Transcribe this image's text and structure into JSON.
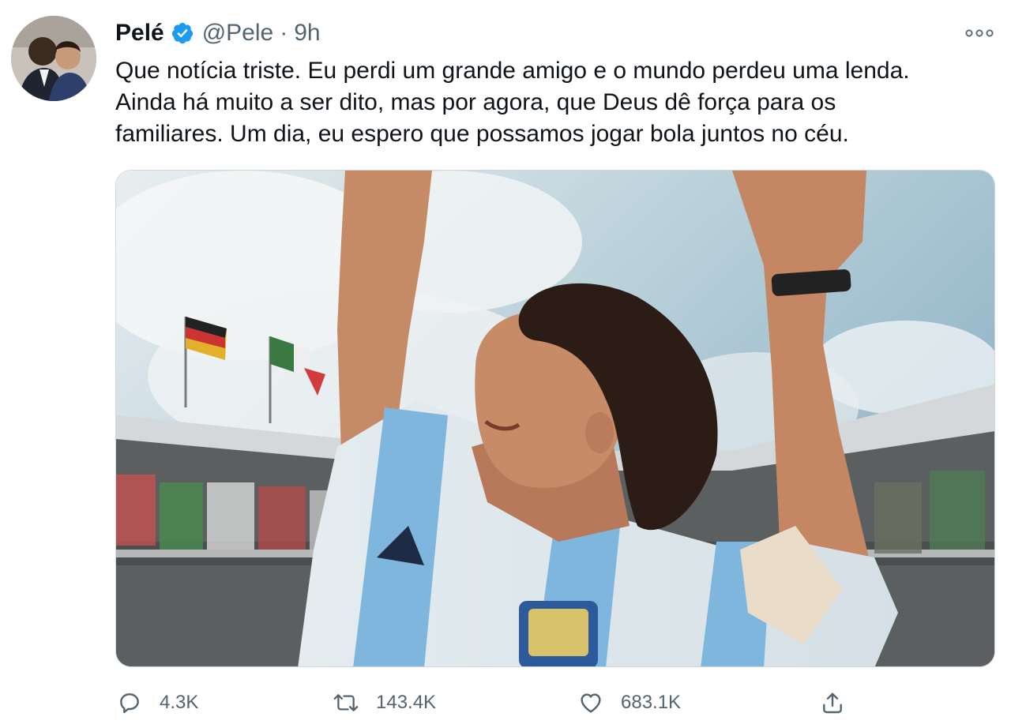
{
  "tweet": {
    "author_name": "Pelé",
    "handle": "@Pele",
    "separator": "·",
    "time": "9h",
    "text_lines": [
      "Que notícia triste. Eu perdi um grande amigo e o mundo perdeu uma lenda.",
      "Ainda há muito a ser dito, mas por agora, que Deus dê força para os",
      "familiares. Um dia, eu espero que possamos jogar bola juntos no céu."
    ],
    "image_subject": "football player in Argentina jersey celebrating with raised arms in a stadium"
  },
  "actions": {
    "reply_count": "4.3K",
    "retweet_count": "143.4K",
    "like_count": "683.1K"
  },
  "icons": {
    "verified": "verified-badge-icon",
    "more": "more-options-icon",
    "reply": "reply-icon",
    "retweet": "retweet-icon",
    "like": "heart-icon",
    "share": "share-icon"
  },
  "colors": {
    "verified_blue": "#1d9bf0",
    "secondary_text": "#536471",
    "primary_text": "#0f1419"
  }
}
